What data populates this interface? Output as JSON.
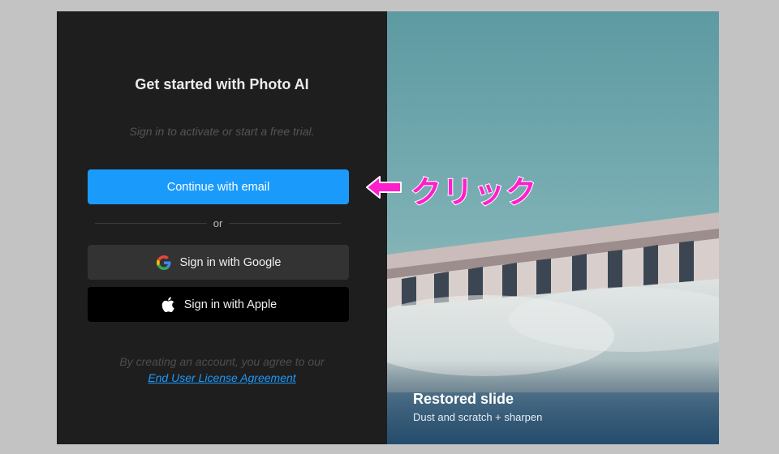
{
  "login": {
    "title": "Get started with Photo AI",
    "subtitle": "Sign in to activate or start a free trial.",
    "email_button": "Continue with email",
    "divider_text": "or",
    "google_button": "Sign in with Google",
    "apple_button": "Sign in with Apple",
    "legal_text": "By creating an account, you agree to our",
    "legal_link": "End User License Agreement"
  },
  "showcase": {
    "caption_title": "Restored slide",
    "caption_subtitle": "Dust and scratch + sharpen"
  },
  "annotation": {
    "text": "クリック",
    "color": "#ff1ecb",
    "icon": "arrow-left-icon"
  },
  "colors": {
    "accent": "#1a9bfc",
    "panel_bg": "#1e1e1e",
    "google_button_bg": "#333333",
    "apple_button_bg": "#000000"
  }
}
